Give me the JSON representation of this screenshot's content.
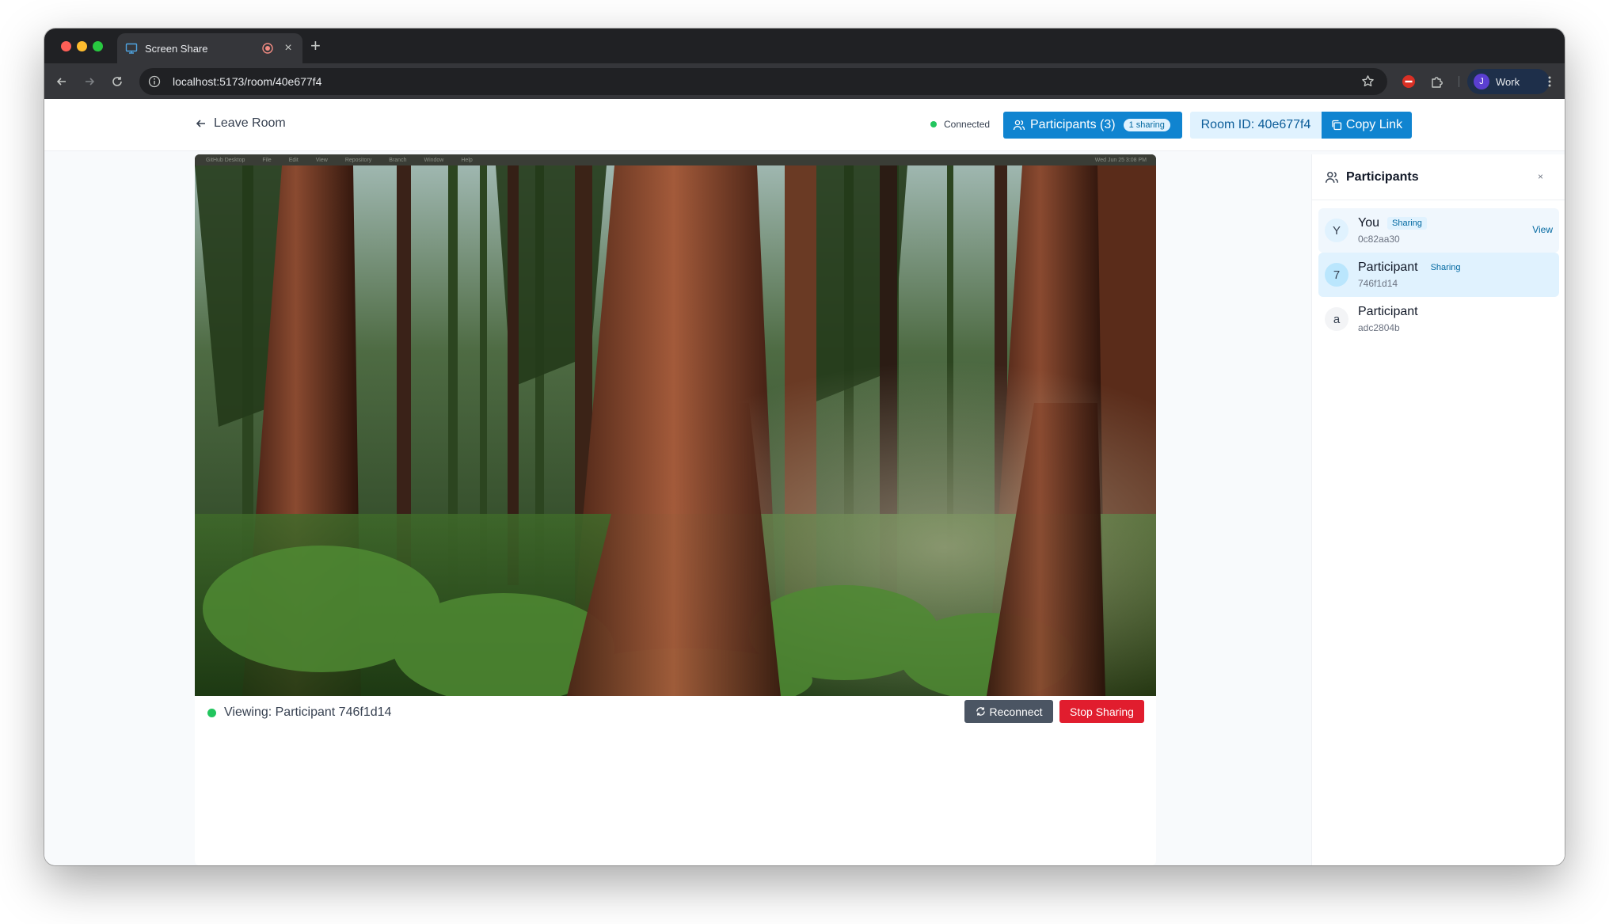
{
  "browser": {
    "tab_title": "Screen Share",
    "url": "localhost:5173/room/40e677f4",
    "profile_initial": "J",
    "profile_name": "Work",
    "new_tab": "+",
    "tab_close": "×"
  },
  "header": {
    "leave_room": "Leave Room",
    "status": "Connected",
    "participants_button": "Participants (3)",
    "sharing_pill": "1 sharing",
    "room_id": "Room ID: 40e677f4",
    "copy_link": "Copy Link"
  },
  "shared_screen": {
    "menubar": [
      "GitHub Desktop",
      "File",
      "Edit",
      "View",
      "Repository",
      "Branch",
      "Window",
      "Help"
    ],
    "menubar_right": "Wed Jun 25  3:08 PM"
  },
  "viewer": {
    "viewing_label": "Viewing: Participant 746f1d14",
    "reconnect": "Reconnect",
    "stop_sharing": "Stop Sharing"
  },
  "panel": {
    "title": "Participants",
    "participants": [
      {
        "initial": "Y",
        "name": "You",
        "id": "0c82aa30",
        "badge": "Sharing",
        "action": "View",
        "state": "hover"
      },
      {
        "initial": "7",
        "name": "Participant",
        "id": "746f1d14",
        "badge": "Sharing",
        "state": "selected"
      },
      {
        "initial": "a",
        "name": "Participant",
        "id": "adc2804b",
        "state": "default"
      }
    ]
  },
  "colors": {
    "accent": "#1084d0",
    "accent_light": "#e0f2fe",
    "danger": "#e11d2e",
    "online": "#22c55e",
    "neutral_button": "#4b5563"
  }
}
